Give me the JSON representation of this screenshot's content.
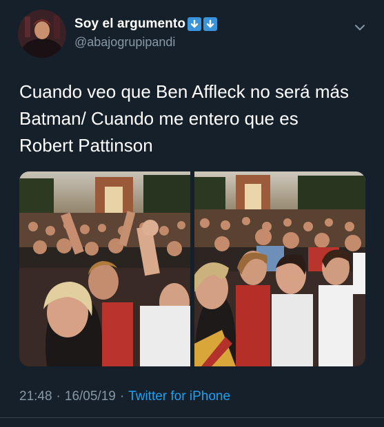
{
  "tweet": {
    "display_name": "Soy el argumento",
    "handle": "@abajogrupipandi",
    "badges": [
      "down-arrow-icon",
      "down-arrow-icon"
    ],
    "text_lines": [
      "Cuando veo que Ben Affleck no será más",
      "Batman/ Cuando me entero que es",
      "Robert Pattinson"
    ],
    "time": "21:48",
    "date": "16/05/19",
    "separator": "·",
    "source": "Twitter for iPhone",
    "media": [
      {
        "description_icon": "crowd-photo-icon"
      },
      {
        "description_icon": "crowd-photo-icon"
      }
    ]
  },
  "colors": {
    "background": "#15202b",
    "text": "#ffffff",
    "secondary": "#8899a6",
    "link": "#1da1f2",
    "badge": "#3b94d9",
    "divider": "#38444d"
  }
}
